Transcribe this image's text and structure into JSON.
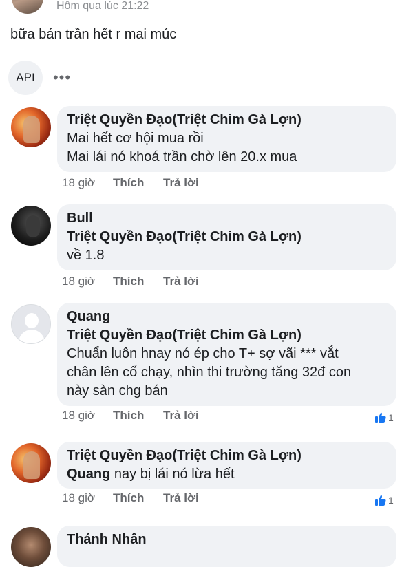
{
  "post": {
    "time": "Hôm qua lúc 21:22",
    "text": "bữa bán trần hết r mai múc"
  },
  "toolbar": {
    "api_label": "API",
    "more_label": "•••"
  },
  "comments": [
    {
      "author": "Triệt Quyền Đạo(Triệt Chim Gà Lợn)",
      "lines": [
        "Mai hết cơ hội mua rồi",
        "Mai lái nó khoá trần chờ lên 20.x mua"
      ],
      "time": "18 giờ",
      "like": "Thích",
      "reply": "Trả lời"
    },
    {
      "author": "Bull",
      "mention": "Triệt Quyền Đạo(Triệt Chim Gà Lợn)",
      "lines": [
        "về 1.8"
      ],
      "time": "18 giờ",
      "like": "Thích",
      "reply": "Trả lời"
    },
    {
      "author": "Quang",
      "mention": "Triệt Quyền Đạo(Triệt Chim Gà Lợn)",
      "lines": [
        "Chuẩn luôn hnay nó ép cho T+ sợ vãi *** vắt",
        "chân lên cổ chạy, nhìn thi trường tăng 32đ con",
        "này sàn chg bán"
      ],
      "time": "18 giờ",
      "like": "Thích",
      "reply": "Trả lời",
      "reaction_count": "1"
    },
    {
      "author": "Triệt Quyền Đạo(Triệt Chim Gà Lợn)",
      "mention": "Quang",
      "text": "nay bị lái nó lừa hết",
      "time": "18 giờ",
      "like": "Thích",
      "reply": "Trả lời",
      "reaction_count": "1"
    },
    {
      "author": "Thánh Nhân"
    }
  ]
}
